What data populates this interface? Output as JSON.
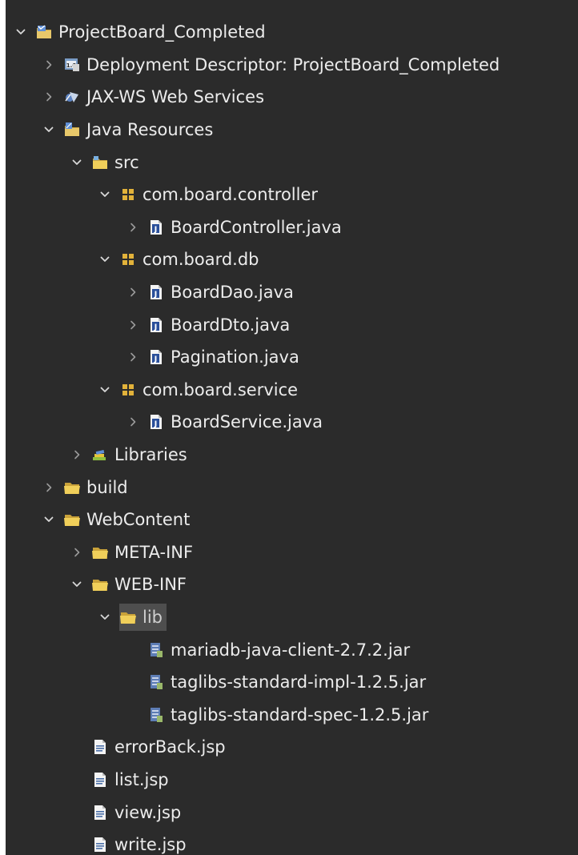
{
  "tree": [
    {
      "label": "ProjectBoard_Completed",
      "depth": 0,
      "twisty": "expanded",
      "icon": "project-icon"
    },
    {
      "label": "Deployment Descriptor: ProjectBoard_Completed",
      "depth": 1,
      "twisty": "collapsed",
      "icon": "deployment-descriptor-icon"
    },
    {
      "label": "JAX-WS Web Services",
      "depth": 1,
      "twisty": "collapsed",
      "icon": "web-services-icon"
    },
    {
      "label": "Java Resources",
      "depth": 1,
      "twisty": "expanded",
      "icon": "java-resources-icon"
    },
    {
      "label": "src",
      "depth": 2,
      "twisty": "expanded",
      "icon": "source-folder-icon"
    },
    {
      "label": "com.board.controller",
      "depth": 3,
      "twisty": "expanded",
      "icon": "package-icon"
    },
    {
      "label": "BoardController.java",
      "depth": 4,
      "twisty": "collapsed",
      "icon": "java-file-icon"
    },
    {
      "label": "com.board.db",
      "depth": 3,
      "twisty": "expanded",
      "icon": "package-icon"
    },
    {
      "label": "BoardDao.java",
      "depth": 4,
      "twisty": "collapsed",
      "icon": "java-file-icon"
    },
    {
      "label": "BoardDto.java",
      "depth": 4,
      "twisty": "collapsed",
      "icon": "java-file-icon"
    },
    {
      "label": "Pagination.java",
      "depth": 4,
      "twisty": "collapsed",
      "icon": "java-file-icon"
    },
    {
      "label": "com.board.service",
      "depth": 3,
      "twisty": "expanded",
      "icon": "package-icon"
    },
    {
      "label": "BoardService.java",
      "depth": 4,
      "twisty": "collapsed",
      "icon": "java-file-icon"
    },
    {
      "label": "Libraries",
      "depth": 2,
      "twisty": "collapsed",
      "icon": "libraries-icon"
    },
    {
      "label": "build",
      "depth": 1,
      "twisty": "collapsed",
      "icon": "folder-icon"
    },
    {
      "label": "WebContent",
      "depth": 1,
      "twisty": "expanded",
      "icon": "folder-icon"
    },
    {
      "label": "META-INF",
      "depth": 2,
      "twisty": "collapsed",
      "icon": "folder-icon"
    },
    {
      "label": "WEB-INF",
      "depth": 2,
      "twisty": "expanded",
      "icon": "folder-icon"
    },
    {
      "label": "lib",
      "depth": 3,
      "twisty": "expanded",
      "icon": "folder-icon",
      "selected": true
    },
    {
      "label": "mariadb-java-client-2.7.2.jar",
      "depth": 4,
      "twisty": "none",
      "icon": "jar-icon"
    },
    {
      "label": "taglibs-standard-impl-1.2.5.jar",
      "depth": 4,
      "twisty": "none",
      "icon": "jar-icon"
    },
    {
      "label": "taglibs-standard-spec-1.2.5.jar",
      "depth": 4,
      "twisty": "none",
      "icon": "jar-icon"
    },
    {
      "label": "errorBack.jsp",
      "depth": 2,
      "twisty": "none",
      "icon": "jsp-file-icon"
    },
    {
      "label": "list.jsp",
      "depth": 2,
      "twisty": "none",
      "icon": "jsp-file-icon"
    },
    {
      "label": "view.jsp",
      "depth": 2,
      "twisty": "none",
      "icon": "jsp-file-icon"
    },
    {
      "label": "write.jsp",
      "depth": 2,
      "twisty": "none",
      "icon": "jsp-file-icon"
    }
  ],
  "colors": {
    "background": "#2b2b2b",
    "text": "#ececec",
    "selection": "#4e4e4e",
    "folder": "#e8c33a",
    "package": "#e2b23a"
  }
}
